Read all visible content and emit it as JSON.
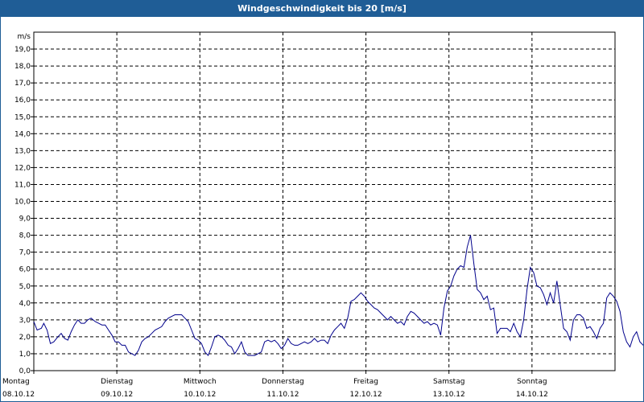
{
  "window": {
    "title": "Windgeschwindigkeit bis 20 [m/s]"
  },
  "chart_data": {
    "type": "line",
    "title": "Windgeschwindigkeit bis 20 [m/s]",
    "ylabel": "m/s",
    "xlabel": "",
    "ylim": [
      0,
      20
    ],
    "yticks": [
      "0,0",
      "1,0",
      "2,0",
      "3,0",
      "4,0",
      "5,0",
      "6,0",
      "7,0",
      "8,0",
      "9,0",
      "10,0",
      "11,0",
      "12,0",
      "13,0",
      "14,0",
      "15,0",
      "16,0",
      "17,0",
      "18,0",
      "19,0"
    ],
    "days": [
      {
        "name": "Montag",
        "date": "08.10.12"
      },
      {
        "name": "Dienstag",
        "date": "09.10.12"
      },
      {
        "name": "Mittwoch",
        "date": "10.10.12"
      },
      {
        "name": "Donnerstag",
        "date": "11.10.12"
      },
      {
        "name": "Freitag",
        "date": "12.10.12"
      },
      {
        "name": "Samstag",
        "date": "13.10.12"
      },
      {
        "name": "Sonntag",
        "date": "14.10.12"
      }
    ],
    "grid": true,
    "line_color": "#00008b",
    "series": [
      {
        "x_unit": "days",
        "points": [
          [
            0.0,
            2.9
          ],
          [
            0.04,
            2.4
          ],
          [
            0.09,
            2.5
          ],
          [
            0.12,
            2.8
          ],
          [
            0.16,
            2.4
          ],
          [
            0.2,
            1.6
          ],
          [
            0.24,
            1.7
          ],
          [
            0.29,
            2.0
          ],
          [
            0.33,
            2.2
          ],
          [
            0.37,
            1.9
          ],
          [
            0.41,
            1.8
          ],
          [
            0.45,
            2.3
          ],
          [
            0.49,
            2.7
          ],
          [
            0.53,
            3.0
          ],
          [
            0.57,
            2.8
          ],
          [
            0.61,
            2.8
          ],
          [
            0.65,
            3.0
          ],
          [
            0.69,
            3.1
          ],
          [
            0.74,
            2.9
          ],
          [
            0.78,
            2.8
          ],
          [
            0.82,
            2.7
          ],
          [
            0.86,
            2.7
          ],
          [
            0.9,
            2.4
          ],
          [
            0.94,
            2.1
          ],
          [
            0.98,
            1.7
          ],
          [
            1.02,
            1.7
          ],
          [
            1.06,
            1.5
          ],
          [
            1.1,
            1.5
          ],
          [
            1.14,
            1.1
          ],
          [
            1.18,
            1.0
          ],
          [
            1.22,
            0.9
          ],
          [
            1.26,
            1.2
          ],
          [
            1.3,
            1.7
          ],
          [
            1.34,
            1.9
          ],
          [
            1.38,
            2.0
          ],
          [
            1.42,
            2.2
          ],
          [
            1.46,
            2.4
          ],
          [
            1.5,
            2.5
          ],
          [
            1.54,
            2.6
          ],
          [
            1.58,
            2.9
          ],
          [
            1.62,
            3.1
          ],
          [
            1.66,
            3.2
          ],
          [
            1.7,
            3.3
          ],
          [
            1.74,
            3.3
          ],
          [
            1.78,
            3.3
          ],
          [
            1.82,
            3.1
          ],
          [
            1.86,
            2.9
          ],
          [
            1.9,
            2.4
          ],
          [
            1.94,
            1.9
          ],
          [
            1.98,
            1.8
          ],
          [
            2.02,
            1.6
          ],
          [
            2.06,
            1.1
          ],
          [
            2.1,
            0.9
          ],
          [
            2.14,
            1.4
          ],
          [
            2.18,
            2.0
          ],
          [
            2.22,
            2.1
          ],
          [
            2.26,
            2.0
          ],
          [
            2.3,
            1.8
          ],
          [
            2.34,
            1.5
          ],
          [
            2.38,
            1.4
          ],
          [
            2.42,
            1.0
          ],
          [
            2.46,
            1.3
          ],
          [
            2.5,
            1.7
          ],
          [
            2.54,
            1.1
          ],
          [
            2.58,
            0.9
          ],
          [
            2.62,
            0.9
          ],
          [
            2.66,
            0.9
          ],
          [
            2.7,
            1.0
          ],
          [
            2.74,
            1.1
          ],
          [
            2.78,
            1.7
          ],
          [
            2.82,
            1.8
          ],
          [
            2.86,
            1.7
          ],
          [
            2.9,
            1.8
          ],
          [
            2.94,
            1.6
          ],
          [
            2.98,
            1.3
          ],
          [
            3.02,
            1.5
          ],
          [
            3.06,
            1.9
          ],
          [
            3.1,
            1.6
          ],
          [
            3.14,
            1.5
          ],
          [
            3.18,
            1.5
          ],
          [
            3.22,
            1.6
          ],
          [
            3.26,
            1.7
          ],
          [
            3.3,
            1.6
          ],
          [
            3.34,
            1.7
          ],
          [
            3.38,
            1.9
          ],
          [
            3.42,
            1.7
          ],
          [
            3.46,
            1.8
          ],
          [
            3.5,
            1.8
          ],
          [
            3.54,
            1.6
          ],
          [
            3.58,
            2.1
          ],
          [
            3.62,
            2.4
          ],
          [
            3.66,
            2.6
          ],
          [
            3.7,
            2.8
          ],
          [
            3.74,
            2.5
          ],
          [
            3.78,
            3.1
          ],
          [
            3.82,
            4.1
          ],
          [
            3.86,
            4.2
          ],
          [
            3.9,
            4.4
          ],
          [
            3.94,
            4.6
          ],
          [
            3.98,
            4.4
          ],
          [
            4.02,
            4.1
          ],
          [
            4.06,
            3.9
          ],
          [
            4.1,
            3.7
          ],
          [
            4.14,
            3.6
          ],
          [
            4.18,
            3.4
          ],
          [
            4.22,
            3.2
          ],
          [
            4.26,
            3.0
          ],
          [
            4.3,
            3.2
          ],
          [
            4.34,
            3.0
          ],
          [
            4.38,
            2.8
          ],
          [
            4.42,
            2.9
          ],
          [
            4.46,
            2.7
          ],
          [
            4.5,
            3.2
          ],
          [
            4.54,
            3.5
          ],
          [
            4.58,
            3.4
          ],
          [
            4.62,
            3.2
          ],
          [
            4.66,
            3.0
          ],
          [
            4.7,
            2.8
          ],
          [
            4.74,
            2.9
          ],
          [
            4.78,
            2.7
          ],
          [
            4.82,
            2.8
          ],
          [
            4.86,
            2.7
          ],
          [
            4.9,
            2.1
          ],
          [
            4.94,
            3.7
          ],
          [
            4.98,
            4.7
          ],
          [
            5.02,
            5.0
          ],
          [
            5.06,
            5.6
          ],
          [
            5.1,
            6.0
          ],
          [
            5.14,
            6.2
          ],
          [
            5.18,
            6.1
          ],
          [
            5.22,
            7.3
          ],
          [
            5.26,
            8.0
          ],
          [
            5.3,
            6.3
          ],
          [
            5.34,
            4.8
          ],
          [
            5.38,
            4.6
          ],
          [
            5.42,
            4.2
          ],
          [
            5.46,
            4.4
          ],
          [
            5.5,
            3.6
          ],
          [
            5.54,
            3.7
          ],
          [
            5.58,
            2.2
          ],
          [
            5.62,
            2.5
          ],
          [
            5.66,
            2.5
          ],
          [
            5.7,
            2.5
          ],
          [
            5.74,
            2.3
          ],
          [
            5.78,
            2.8
          ],
          [
            5.82,
            2.3
          ],
          [
            5.86,
            2.0
          ],
          [
            5.9,
            3.0
          ],
          [
            5.94,
            4.8
          ],
          [
            5.98,
            6.1
          ],
          [
            6.02,
            5.8
          ],
          [
            6.06,
            5.0
          ],
          [
            6.1,
            4.9
          ],
          [
            6.14,
            4.5
          ],
          [
            6.18,
            3.9
          ],
          [
            6.22,
            4.6
          ],
          [
            6.26,
            4.0
          ],
          [
            6.3,
            5.3
          ],
          [
            6.34,
            3.9
          ],
          [
            6.38,
            2.5
          ],
          [
            6.42,
            2.3
          ],
          [
            6.46,
            1.8
          ],
          [
            6.5,
            3.0
          ],
          [
            6.54,
            3.3
          ],
          [
            6.58,
            3.3
          ],
          [
            6.62,
            3.1
          ],
          [
            6.66,
            2.5
          ],
          [
            6.7,
            2.6
          ],
          [
            6.74,
            2.3
          ],
          [
            6.78,
            1.9
          ],
          [
            6.82,
            2.5
          ],
          [
            6.86,
            2.8
          ],
          [
            6.9,
            4.3
          ],
          [
            6.94,
            4.6
          ],
          [
            6.98,
            4.4
          ],
          [
            7.02,
            4.1
          ],
          [
            7.06,
            3.5
          ],
          [
            7.1,
            2.3
          ],
          [
            7.14,
            1.7
          ],
          [
            7.18,
            1.4
          ],
          [
            7.22,
            2.0
          ],
          [
            7.26,
            2.3
          ],
          [
            7.3,
            1.7
          ],
          [
            7.34,
            1.5
          ],
          [
            7.38,
            1.1
          ],
          [
            7.42,
            1.0
          ],
          [
            7.46,
            1.1
          ],
          [
            7.5,
            1.4
          ]
        ]
      }
    ]
  }
}
